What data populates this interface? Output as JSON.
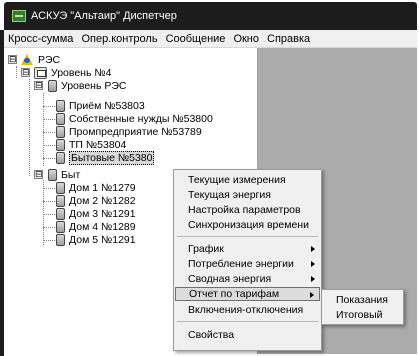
{
  "window": {
    "title": "АСКУЭ \"Альтаир\" Диспетчер",
    "app_icon": "app-icon"
  },
  "menubar": {
    "items": [
      "Кросс-сумма",
      "Опер.контроль",
      "Сообщение",
      "Окно",
      "Справка"
    ]
  },
  "tree": {
    "root": {
      "label": "РЭС",
      "expander": "⊟",
      "icon": "rc-icon"
    },
    "level4": {
      "label": "Уровень №4",
      "expander": "⊟",
      "icon": "level-icon"
    },
    "level_res": {
      "label": "Уровень РЭС",
      "expander": "⊟",
      "icon": "level-icon"
    },
    "res_children": [
      {
        "label": "Приём №53803"
      },
      {
        "label": "Собственные нужды №53800"
      },
      {
        "label": "Промпредприятие №53789"
      },
      {
        "label": "ТП №53804"
      },
      {
        "label": "Бытовые №5380"
      }
    ],
    "byt": {
      "label": "Быт",
      "expander": "⊟"
    },
    "byt_children": [
      {
        "label": "Дом 1 №1279"
      },
      {
        "label": "Дом 2 №1282"
      },
      {
        "label": "Дом 3 №1291"
      },
      {
        "label": "Дом 4 №1289"
      },
      {
        "label": "Дом 5 №1291"
      }
    ]
  },
  "context_menu": {
    "items": [
      {
        "label": "Текущие измерения",
        "submenu": false
      },
      {
        "label": "Текущая энергия",
        "submenu": false
      },
      {
        "label": "Настройка параметров",
        "submenu": false
      },
      {
        "label": "Синхронизация времени",
        "submenu": false
      },
      {
        "label": "График",
        "submenu": true
      },
      {
        "label": "Потребление энергии",
        "submenu": true
      },
      {
        "label": "Сводная энергия",
        "submenu": true
      },
      {
        "label": "Отчет по тарифам",
        "submenu": true,
        "active": true
      },
      {
        "label": "Включения-отключения",
        "submenu": false
      },
      {
        "label": "Свойства",
        "submenu": false
      }
    ]
  },
  "submenu": {
    "items": [
      {
        "label": "Показания"
      },
      {
        "label": "Итоговый"
      }
    ]
  }
}
